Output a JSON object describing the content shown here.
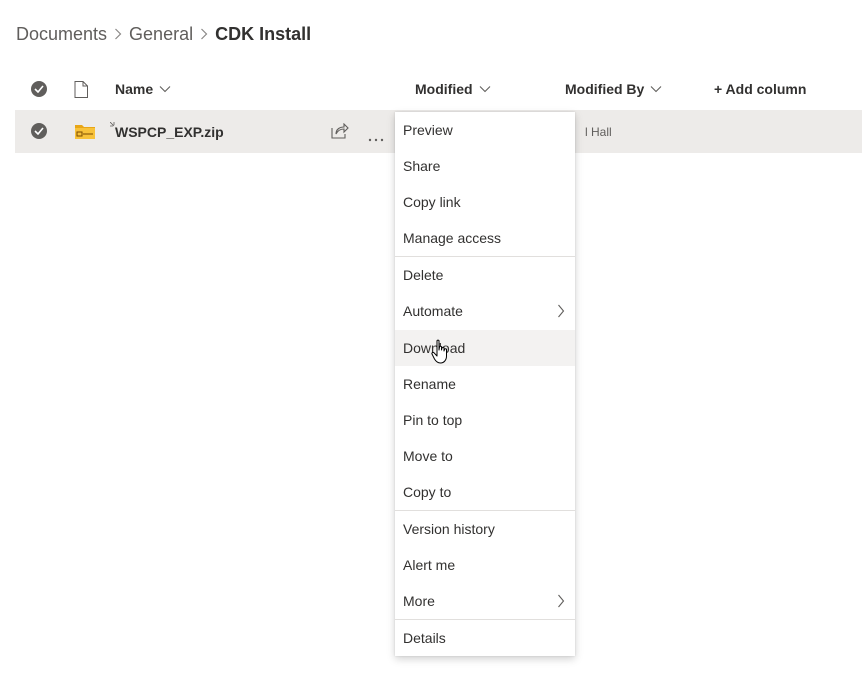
{
  "breadcrumb": {
    "items": [
      "Documents",
      "General"
    ],
    "current": "CDK Install"
  },
  "columns": {
    "name": "Name",
    "modified": "Modified",
    "modified_by": "Modified By",
    "add_column": "+ Add column"
  },
  "file": {
    "name": "WSPCP_EXP.zip",
    "modified_by_partial": "l Hall"
  },
  "menu": {
    "items": [
      {
        "label": "Preview"
      },
      {
        "label": "Share"
      },
      {
        "label": "Copy link"
      },
      {
        "label": "Manage access"
      },
      {
        "label": "Delete"
      },
      {
        "label": "Automate"
      },
      {
        "label": "Download"
      },
      {
        "label": "Rename"
      },
      {
        "label": "Pin to top"
      },
      {
        "label": "Move to"
      },
      {
        "label": "Copy to"
      },
      {
        "label": "Version history"
      },
      {
        "label": "Alert me"
      },
      {
        "label": "More"
      },
      {
        "label": "Details"
      }
    ]
  },
  "colors": {
    "accent": "#0078d4",
    "selected_row": "#edebe9",
    "hover": "#f3f2f1",
    "folder_zip": "#f8c23a"
  },
  "icons": {
    "select_all": "check-circle-icon",
    "file_type": "document-icon",
    "row_check": "check-circle-icon",
    "zip": "zip-folder-icon",
    "share": "share-icon",
    "more": "more-ellipsis-icon",
    "submenu": "chevron-right-icon",
    "cursor": "hand-pointer-icon"
  }
}
